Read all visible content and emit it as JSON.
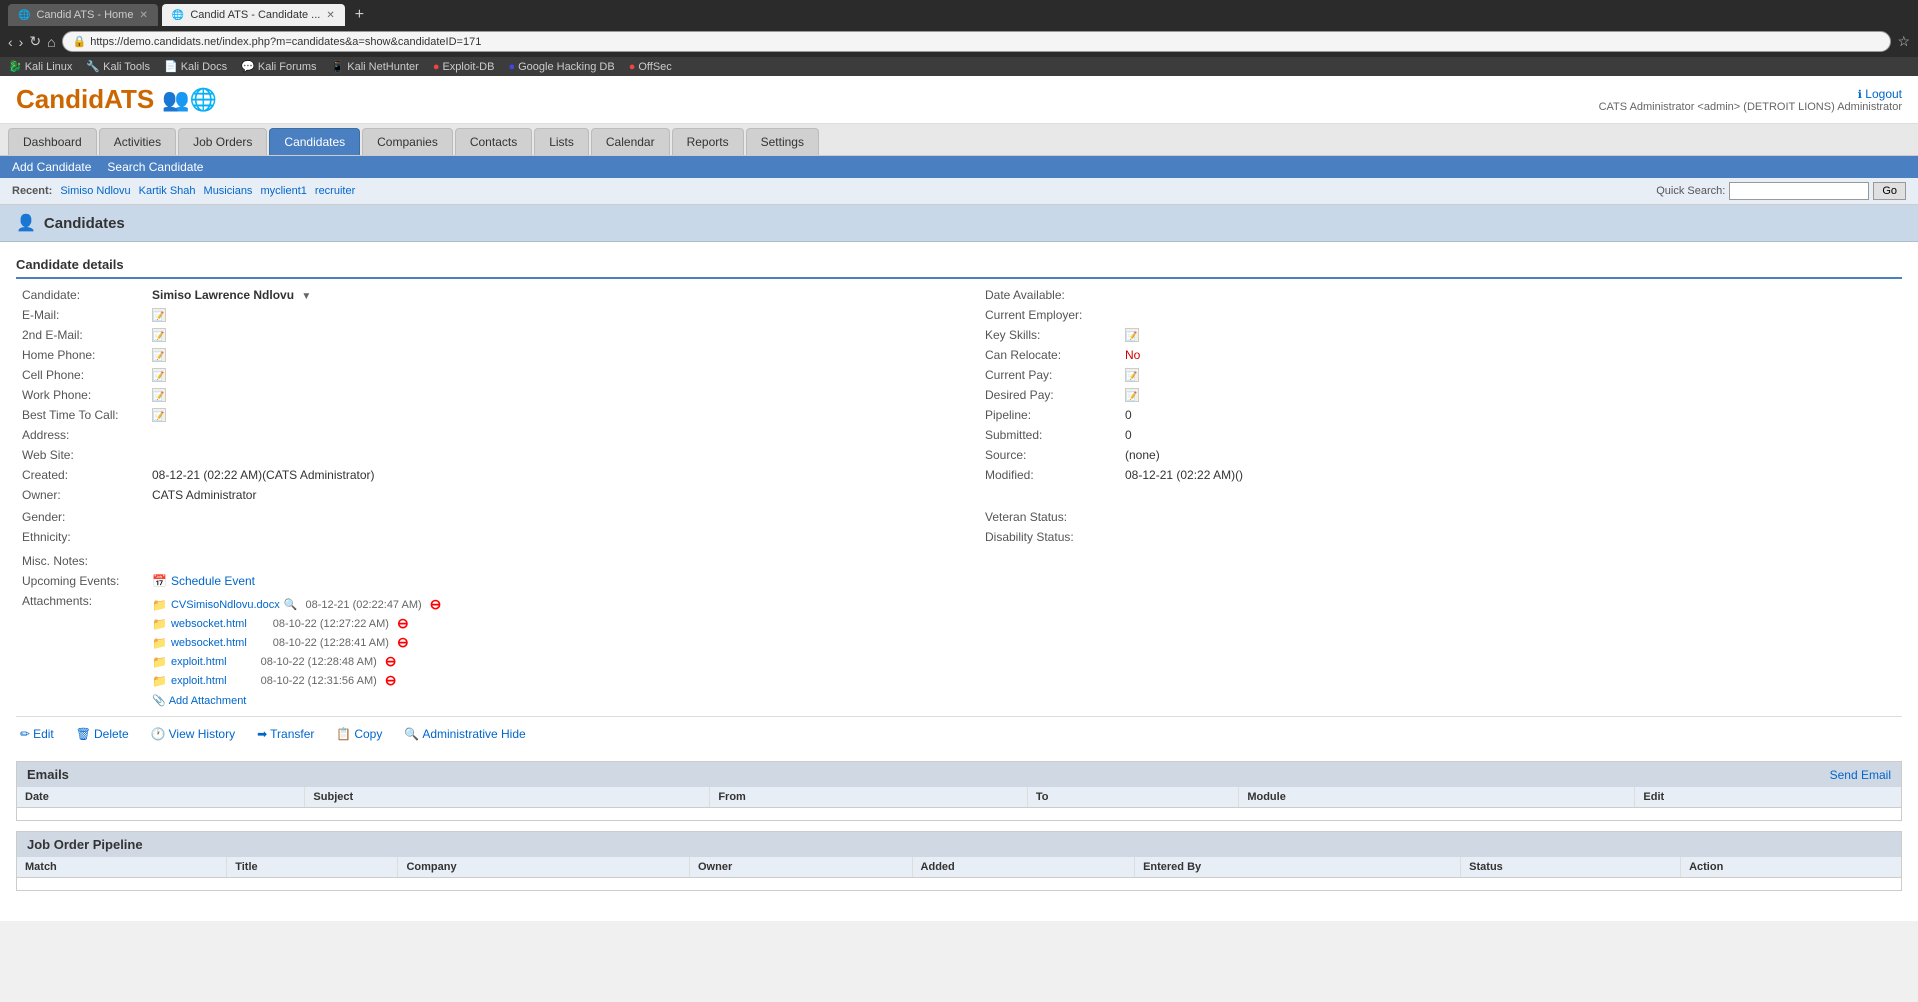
{
  "browser": {
    "tabs": [
      {
        "id": "tab1",
        "title": "Candid ATS - Home",
        "active": false
      },
      {
        "id": "tab2",
        "title": "Candid ATS - Candidate ...",
        "active": true
      }
    ],
    "url": "https://demo.candidats.net/index.php?m=candidates&a=show&candidateID=171",
    "url_display": "https://demo.candidats.net/index.php?m=candidates&a=show&candidateID=171",
    "bookmarks": [
      {
        "label": "Kali Linux",
        "icon": "🐉"
      },
      {
        "label": "Kali Tools",
        "icon": "🔧"
      },
      {
        "label": "Kali Docs",
        "icon": "📄"
      },
      {
        "label": "Kali Forums",
        "icon": "💬"
      },
      {
        "label": "Kali NetHunter",
        "icon": "📱"
      },
      {
        "label": "Exploit-DB",
        "icon": "🔴"
      },
      {
        "label": "Google Hacking DB",
        "icon": "🔵"
      },
      {
        "label": "OffSec",
        "icon": "🔴"
      }
    ]
  },
  "app": {
    "logo": "CandidATS",
    "user_info": "CATS Administrator <admin> (DETROIT LIONS)  Administrator",
    "logout_label": "Logout",
    "nav": [
      {
        "id": "dashboard",
        "label": "Dashboard"
      },
      {
        "id": "activities",
        "label": "Activities"
      },
      {
        "id": "job-orders",
        "label": "Job Orders"
      },
      {
        "id": "candidates",
        "label": "Candidates",
        "active": true
      },
      {
        "id": "companies",
        "label": "Companies"
      },
      {
        "id": "contacts",
        "label": "Contacts"
      },
      {
        "id": "lists",
        "label": "Lists"
      },
      {
        "id": "calendar",
        "label": "Calendar"
      },
      {
        "id": "reports",
        "label": "Reports"
      },
      {
        "id": "settings",
        "label": "Settings"
      }
    ],
    "sub_nav": [
      {
        "id": "add-candidate",
        "label": "Add Candidate"
      },
      {
        "id": "search-candidate",
        "label": "Search Candidate"
      }
    ],
    "recent": {
      "label": "Recent:",
      "items": [
        "Simiso Ndlovu",
        "Kartik Shah",
        "Musicians",
        "myclient1",
        "recruiter"
      ]
    },
    "quick_search": {
      "label": "Quick Search:",
      "placeholder": "",
      "button_label": "Go"
    },
    "page_title": "Candidates",
    "page_icon": "👤"
  },
  "candidate": {
    "section_label": "Candidate details",
    "fields": {
      "candidate_label": "Candidate:",
      "candidate_name": "Simiso Lawrence Ndlovu",
      "email_label": "E-Mail:",
      "email_value": "",
      "email2_label": "2nd E-Mail:",
      "email2_value": "",
      "home_phone_label": "Home Phone:",
      "home_phone_value": "",
      "cell_phone_label": "Cell Phone:",
      "cell_phone_value": "",
      "work_phone_label": "Work Phone:",
      "work_phone_value": "",
      "best_time_label": "Best Time To Call:",
      "best_time_value": "",
      "address_label": "Address:",
      "address_value": "",
      "website_label": "Web Site:",
      "website_value": "",
      "created_label": "Created:",
      "created_value": "08-12-21 (02:22 AM)(CATS Administrator)",
      "owner_label": "Owner:",
      "owner_value": "CATS Administrator",
      "gender_label": "Gender:",
      "gender_value": "",
      "ethnicity_label": "Ethnicity:",
      "ethnicity_value": "",
      "misc_notes_label": "Misc. Notes:",
      "misc_notes_value": "",
      "upcoming_events_label": "Upcoming Events:",
      "upcoming_events_value": "",
      "attachments_label": "Attachments:"
    },
    "right_fields": {
      "date_available_label": "Date Available:",
      "date_available_value": "",
      "current_employer_label": "Current Employer:",
      "current_employer_value": "",
      "key_skills_label": "Key Skills:",
      "key_skills_value": "",
      "can_relocate_label": "Can Relocate:",
      "can_relocate_value": "No",
      "current_pay_label": "Current Pay:",
      "current_pay_value": "",
      "desired_pay_label": "Desired Pay:",
      "desired_pay_value": "",
      "pipeline_label": "Pipeline:",
      "pipeline_value": "0",
      "submitted_label": "Submitted:",
      "submitted_value": "0",
      "source_label": "Source:",
      "source_value": "(none)",
      "modified_label": "Modified:",
      "modified_value": "08-12-21 (02:22 AM)()",
      "veteran_status_label": "Veteran Status:",
      "veteran_status_value": "",
      "disability_status_label": "Disability Status:",
      "disability_status_value": ""
    },
    "attachments": [
      {
        "name": "CVSimisoNdlovu.docx",
        "date": "08-12-21 (02:22:47 AM)",
        "has_search": true
      },
      {
        "name": "websocket.html",
        "date": "08-10-22 (12:27:22 AM)",
        "has_search": false
      },
      {
        "name": "websocket.html",
        "date": "08-10-22 (12:28:41 AM)",
        "has_search": false
      },
      {
        "name": "exploit.html",
        "date": "08-10-22 (12:28:48 AM)",
        "has_search": false
      },
      {
        "name": "exploit.html",
        "date": "08-10-22 (12:31:56 AM)",
        "has_search": false
      }
    ],
    "schedule_event_label": "Schedule Event",
    "add_attachment_label": "Add Attachment",
    "actions": [
      {
        "id": "edit",
        "label": "Edit",
        "icon": "✏️"
      },
      {
        "id": "delete",
        "label": "Delete",
        "icon": "🗑️"
      },
      {
        "id": "view-history",
        "label": "View History",
        "icon": "🕐"
      },
      {
        "id": "transfer",
        "label": "Transfer",
        "icon": "➡️"
      },
      {
        "id": "copy",
        "label": "Copy",
        "icon": "📋"
      },
      {
        "id": "admin-hide",
        "label": "Administrative Hide",
        "icon": "🔍"
      }
    ]
  },
  "emails": {
    "section_label": "Emails",
    "send_email_label": "Send Email",
    "columns": [
      "Date",
      "Subject",
      "From",
      "To",
      "Module",
      "Edit"
    ],
    "rows": []
  },
  "job_order_pipeline": {
    "section_label": "Job Order Pipeline",
    "columns": [
      "Match",
      "Title",
      "Company",
      "Owner",
      "Added",
      "Entered By",
      "Status",
      "Action"
    ],
    "rows": []
  }
}
